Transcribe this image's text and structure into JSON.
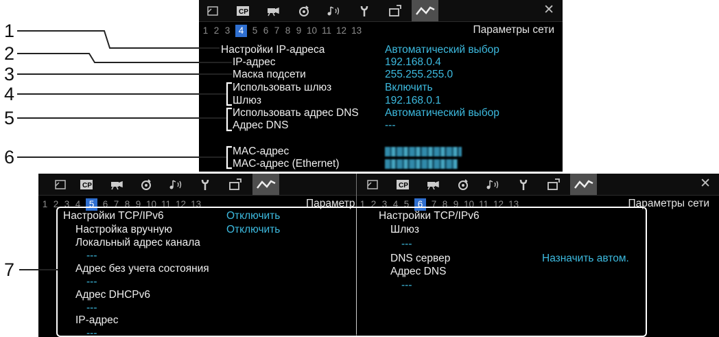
{
  "close_symbol": "✕",
  "top": {
    "pages": [
      "1",
      "2",
      "3",
      "4",
      "5",
      "6",
      "7",
      "8",
      "9",
      "10",
      "11",
      "12",
      "13"
    ],
    "current_page": "4",
    "title": "Параметры сети",
    "rows": [
      {
        "label": "Настройки IP-адреса",
        "value": "Автоматический выбор"
      },
      {
        "label": "IP-адрес",
        "value": "192.168.0.4"
      },
      {
        "label": "Маска подсети",
        "value": "255.255.255.0"
      },
      {
        "label": "Использовать шлюз",
        "value": "Включить"
      },
      {
        "label": "Шлюз",
        "value": "192.168.0.1"
      },
      {
        "label": "Использовать адрес DNS",
        "value": "Автоматический выбор"
      },
      {
        "label": "Адрес DNS",
        "value": "---"
      },
      {
        "label": "MAC-адрес",
        "value": ""
      },
      {
        "label": "MAC-адрес (Ethernet)",
        "value": ""
      }
    ]
  },
  "left": {
    "pages": [
      "1",
      "2",
      "3",
      "4",
      "5",
      "6",
      "7",
      "8",
      "9",
      "10",
      "11",
      "12",
      "13"
    ],
    "current_page": "5",
    "title": "Параметр",
    "heading": "Настройки TCP/IPv6",
    "heading_value": "Отключить",
    "rows": [
      {
        "label": "Настройка вручную",
        "value": "Отключить"
      },
      {
        "label": "Локальный адрес канала",
        "value": "---"
      },
      {
        "label": "Адрес без учета состояния",
        "value": "---"
      },
      {
        "label": "Адрес DHCPv6",
        "value": "---"
      },
      {
        "label": "IP-адрес",
        "value": "---"
      }
    ]
  },
  "right": {
    "pages": [
      "1",
      "2",
      "3",
      "4",
      "5",
      "6",
      "7",
      "8",
      "9",
      "10",
      "11",
      "12",
      "13"
    ],
    "current_page": "6",
    "title": "Параметры сети",
    "heading": "Настройки TCP/IPv6",
    "gateway_label": "Шлюз",
    "gateway_value": "---",
    "dns_server_label": "DNS сервер",
    "dns_server_value": "Назначить автом.",
    "dns_address_label": "Адрес DNS",
    "dns_address_value": "---"
  },
  "callouts": [
    "1",
    "2",
    "3",
    "4",
    "5",
    "6",
    "7"
  ],
  "tab_icons": [
    "camera-frame-icon",
    "cp-icon",
    "movie-camera-icon",
    "record-icon",
    "audio-icon",
    "wrench-icon",
    "tools-icon",
    "network-icon"
  ],
  "colors": {
    "value": "#3dbbe0",
    "label": "#efefef",
    "page_highlight": "#2f6fd0",
    "panel_bg": "#000000"
  }
}
